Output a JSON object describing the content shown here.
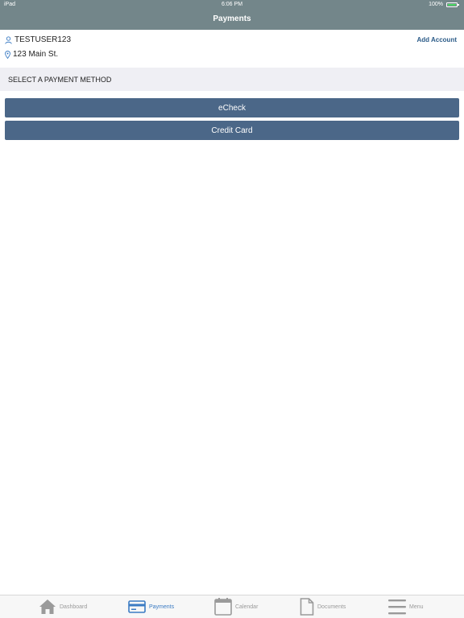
{
  "status_bar": {
    "device": "iPad",
    "time": "6:06 PM",
    "battery": "100%"
  },
  "nav": {
    "title": "Payments"
  },
  "account": {
    "username": "TESTUSER123",
    "address": "123 Main St.",
    "add_account": "Add Account"
  },
  "section": {
    "header": "SELECT A PAYMENT METHOD"
  },
  "payment_methods": [
    "eCheck",
    "Credit Card"
  ],
  "tabs": [
    {
      "label": "Dashboard",
      "icon": "home-icon"
    },
    {
      "label": "Payments",
      "icon": "card-icon",
      "active": true
    },
    {
      "label": "Calendar",
      "icon": "calendar-icon"
    },
    {
      "label": "Documents",
      "icon": "document-icon"
    },
    {
      "label": "Menu",
      "icon": "menu-icon"
    }
  ],
  "colors": {
    "header": "#73868a",
    "button": "#4b6788",
    "link": "#2a5a87",
    "active_tab": "#3b7bc3",
    "section_bg": "#efeff4"
  }
}
